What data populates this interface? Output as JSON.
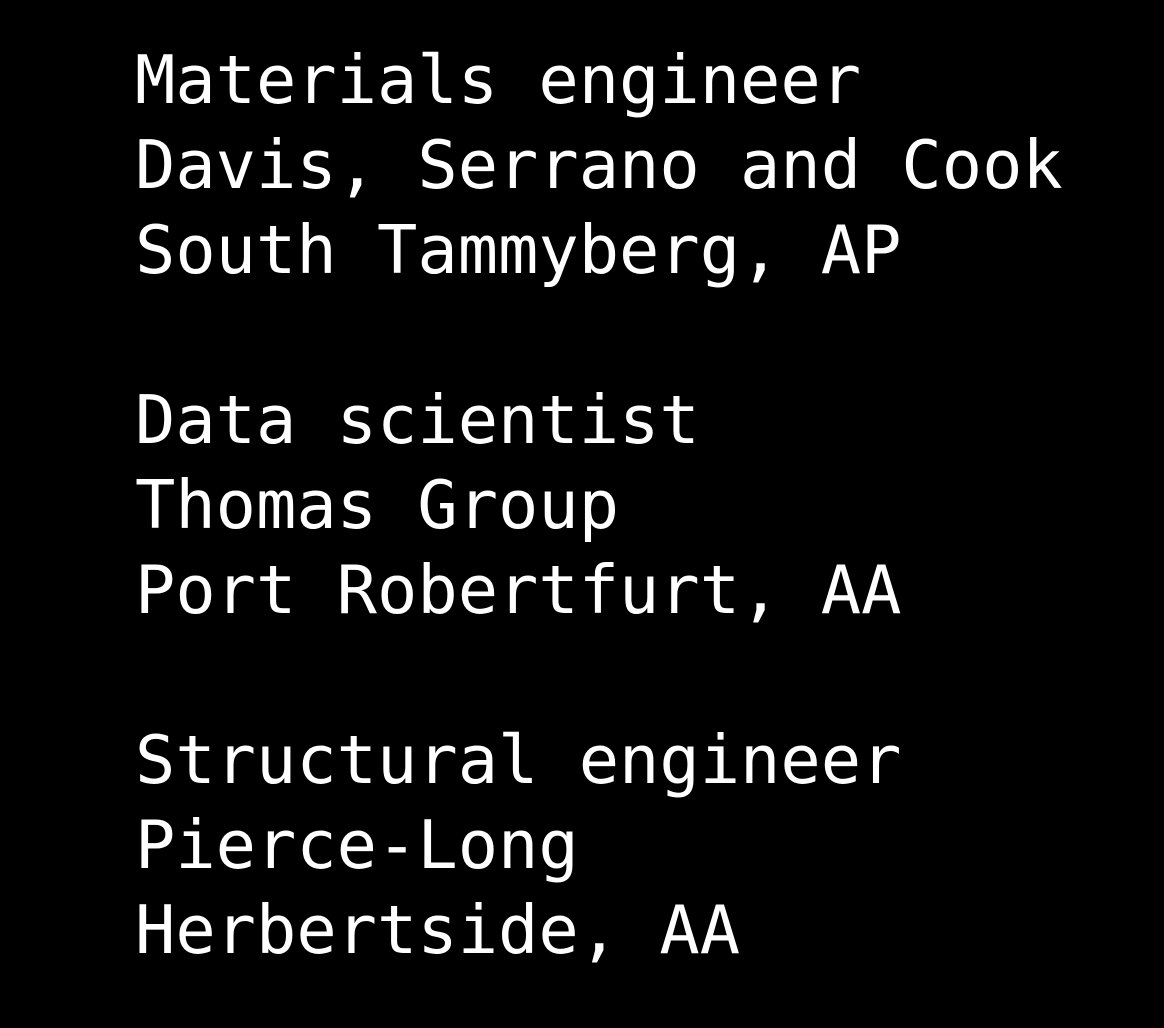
{
  "colors": {
    "background": "#000000",
    "text": "#ffffff"
  },
  "listings": [
    {
      "title": "Materials engineer",
      "company": "Davis, Serrano and Cook",
      "location": "South Tammyberg, AP"
    },
    {
      "title": "Data scientist",
      "company": "Thomas Group",
      "location": "Port Robertfurt, AA"
    },
    {
      "title": "Structural engineer",
      "company": "Pierce-Long",
      "location": "Herbertside, AA"
    }
  ]
}
